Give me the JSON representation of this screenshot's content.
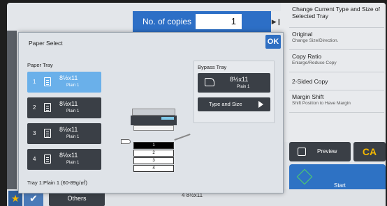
{
  "copies": {
    "label": "No. of copies",
    "value": "1"
  },
  "menu": [
    {
      "title": "Change Current Type and Size of Selected Tray",
      "sub": ""
    },
    {
      "title": "Original",
      "sub": "Change Size/Direction."
    },
    {
      "title": "Copy Ratio",
      "sub": "Enlarge/Reduce Copy"
    },
    {
      "title": "2-Sided Copy",
      "sub": ""
    },
    {
      "title": "Margin Shift",
      "sub": "Shift Position to Have Margin"
    }
  ],
  "buttons": {
    "preview": "Preview",
    "ca": "CA",
    "start": "Start",
    "others": "Others",
    "ok": "OK"
  },
  "dialog": {
    "title": "Paper Select",
    "paper_tray_header": "Paper Tray",
    "trays": [
      {
        "num": "1",
        "size": "8½x11",
        "type": "Plain 1",
        "selected": true
      },
      {
        "num": "2",
        "size": "8½x11",
        "type": "Plain 1",
        "selected": false
      },
      {
        "num": "3",
        "size": "8½x11",
        "type": "Plain 1",
        "selected": false
      },
      {
        "num": "4",
        "size": "8½x11",
        "type": "Plain 1",
        "selected": false
      }
    ],
    "status": "Tray 1:Plain 1 (60-89g/㎡)",
    "bypass": {
      "header": "Bypass Tray",
      "size": "8½x11",
      "type": "Plain 1",
      "type_and_size": "Type and Size"
    },
    "machine_trays": [
      "1",
      "2",
      "3",
      "4"
    ]
  },
  "bottom_tray_info": "4  8½x11",
  "colors": {
    "accent": "#2f6fc2",
    "selected_tray": "#6ab0ea",
    "dark_button": "#3a3f46",
    "ca": "#f5b800"
  }
}
